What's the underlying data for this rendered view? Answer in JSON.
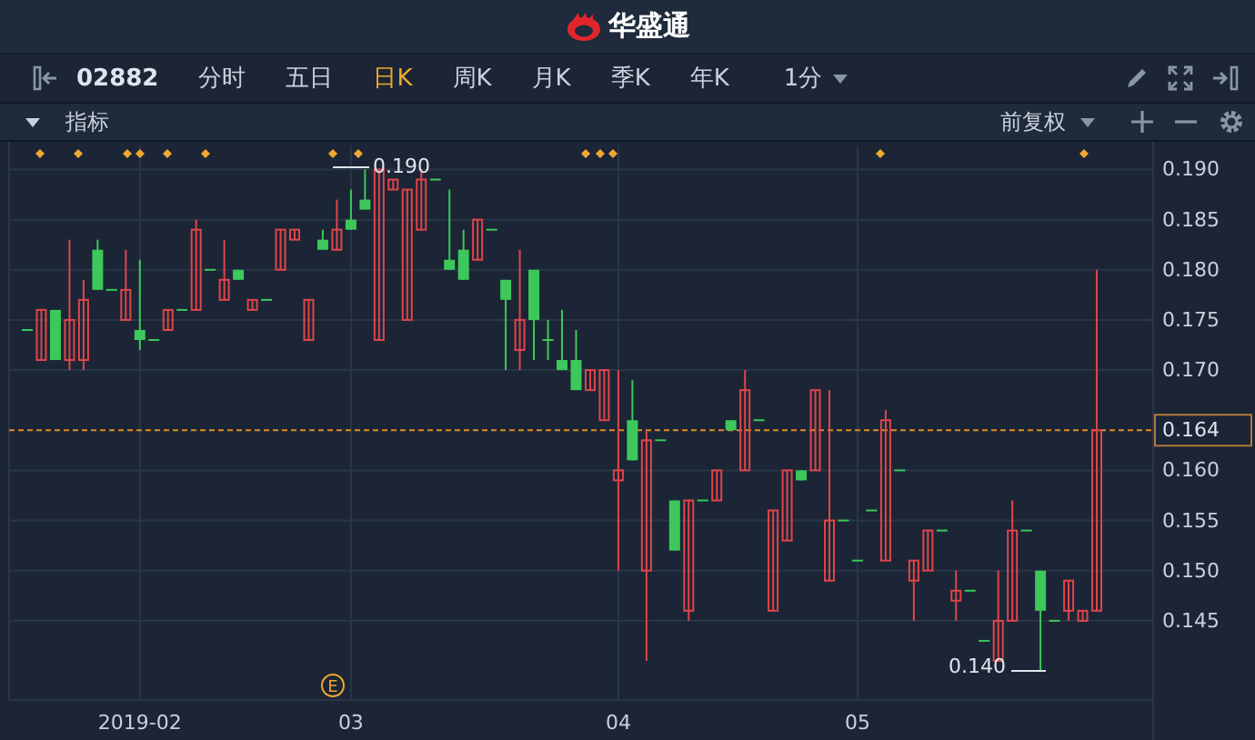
{
  "app_title": "华盛通",
  "toolbar": {
    "symbol": "02882",
    "periods": [
      {
        "label": "分时",
        "selected": false
      },
      {
        "label": "五日",
        "selected": false
      },
      {
        "label": "日K",
        "selected": true
      },
      {
        "label": "周K",
        "selected": false
      },
      {
        "label": "月K",
        "selected": false
      },
      {
        "label": "季K",
        "selected": false
      },
      {
        "label": "年K",
        "selected": false
      }
    ],
    "interval": "1分"
  },
  "indicator_bar": {
    "label": "指标",
    "adjustment": "前复权"
  },
  "chart": {
    "high_label": "0.190",
    "low_label": "0.140",
    "event_marker": "E",
    "chart_data": {
      "type": "candlestick",
      "ylim": [
        0.1371,
        0.1924
      ],
      "grid": true,
      "ref_lines": [
        {
          "axis": "y",
          "value": 0.164,
          "label": "0.164"
        }
      ],
      "yticks": [
        {
          "value": 0.19,
          "label": "0.190"
        },
        {
          "value": 0.185,
          "label": "0.185"
        },
        {
          "value": 0.18,
          "label": "0.180"
        },
        {
          "value": 0.175,
          "label": "0.175"
        },
        {
          "value": 0.17,
          "label": "0.170"
        },
        {
          "value": 0.16,
          "label": "0.160"
        },
        {
          "value": 0.155,
          "label": "0.155"
        },
        {
          "value": 0.15,
          "label": "0.150"
        },
        {
          "value": 0.145,
          "label": "0.145"
        }
      ],
      "categories": [
        null,
        null,
        null,
        null,
        null,
        null,
        null,
        null,
        "2019-02",
        null,
        null,
        null,
        null,
        null,
        null,
        null,
        null,
        null,
        null,
        null,
        null,
        null,
        null,
        "03",
        null,
        null,
        null,
        null,
        null,
        null,
        null,
        null,
        null,
        null,
        null,
        null,
        null,
        null,
        null,
        null,
        null,
        null,
        "04",
        null,
        null,
        null,
        null,
        null,
        null,
        null,
        null,
        null,
        null,
        null,
        null,
        null,
        null,
        null,
        null,
        "05",
        null,
        null,
        null,
        null,
        null,
        null,
        null,
        null,
        null,
        null,
        null,
        null,
        null,
        null,
        null,
        null,
        null
      ],
      "ohlc": [
        [
          0.174,
          0.174,
          0.174,
          0.174
        ],
        [
          0.171,
          0.176,
          0.171,
          0.176
        ],
        [
          0.176,
          0.176,
          0.171,
          0.171
        ],
        [
          0.171,
          0.183,
          0.17,
          0.175
        ],
        [
          0.171,
          0.179,
          0.17,
          0.177
        ],
        [
          0.182,
          0.183,
          0.178,
          0.178
        ],
        [
          0.178,
          0.178,
          0.178,
          0.178
        ],
        [
          0.175,
          0.182,
          0.175,
          0.178
        ],
        [
          0.174,
          0.181,
          0.172,
          0.173
        ],
        [
          0.173,
          0.173,
          0.173,
          0.173
        ],
        [
          0.174,
          0.176,
          0.174,
          0.176
        ],
        [
          0.176,
          0.176,
          0.176,
          0.176
        ],
        [
          0.176,
          0.185,
          0.176,
          0.184
        ],
        [
          0.18,
          0.18,
          0.18,
          0.18
        ],
        [
          0.177,
          0.183,
          0.177,
          0.179
        ],
        [
          0.18,
          0.18,
          0.179,
          0.179
        ],
        [
          0.176,
          0.177,
          0.176,
          0.177
        ],
        [
          0.177,
          0.177,
          0.177,
          0.177
        ],
        [
          0.18,
          0.184,
          0.18,
          0.184
        ],
        [
          0.183,
          0.184,
          0.183,
          0.184
        ],
        [
          0.173,
          0.177,
          0.173,
          0.177
        ],
        [
          0.183,
          0.184,
          0.182,
          0.182
        ],
        [
          0.182,
          0.187,
          0.182,
          0.184
        ],
        [
          0.185,
          0.188,
          0.184,
          0.184
        ],
        [
          0.187,
          0.19,
          0.186,
          0.186
        ],
        [
          0.173,
          0.19,
          0.173,
          0.19
        ],
        [
          0.188,
          0.189,
          0.188,
          0.189
        ],
        [
          0.175,
          0.188,
          0.175,
          0.188
        ],
        [
          0.184,
          0.19,
          0.184,
          0.189
        ],
        [
          0.189,
          0.189,
          0.189,
          0.189
        ],
        [
          0.181,
          0.188,
          0.18,
          0.18
        ],
        [
          0.182,
          0.184,
          0.179,
          0.179
        ],
        [
          0.181,
          0.185,
          0.181,
          0.185
        ],
        [
          0.184,
          0.184,
          0.184,
          0.184
        ],
        [
          0.179,
          0.179,
          0.17,
          0.177
        ],
        [
          0.172,
          0.182,
          0.17,
          0.175
        ],
        [
          0.18,
          0.18,
          0.171,
          0.175
        ],
        [
          0.173,
          0.175,
          0.171,
          0.173
        ],
        [
          0.171,
          0.176,
          0.17,
          0.17
        ],
        [
          0.171,
          0.174,
          0.168,
          0.168
        ],
        [
          0.168,
          0.17,
          0.168,
          0.17
        ],
        [
          0.165,
          0.17,
          0.165,
          0.17
        ],
        [
          0.159,
          0.17,
          0.15,
          0.16
        ],
        [
          0.165,
          0.169,
          0.161,
          0.161
        ],
        [
          0.15,
          0.164,
          0.141,
          0.163
        ],
        [
          0.163,
          0.163,
          0.163,
          0.163
        ],
        [
          0.157,
          0.157,
          0.152,
          0.152
        ],
        [
          0.146,
          0.157,
          0.145,
          0.157
        ],
        [
          0.157,
          0.157,
          0.157,
          0.157
        ],
        [
          0.157,
          0.16,
          0.157,
          0.16
        ],
        [
          0.165,
          0.165,
          0.164,
          0.164
        ],
        [
          0.16,
          0.17,
          0.16,
          0.168
        ],
        [
          0.165,
          0.165,
          0.165,
          0.165
        ],
        [
          0.146,
          0.156,
          0.146,
          0.156
        ],
        [
          0.153,
          0.16,
          0.153,
          0.16
        ],
        [
          0.16,
          0.16,
          0.159,
          0.159
        ],
        [
          0.16,
          0.168,
          0.16,
          0.168
        ],
        [
          0.149,
          0.168,
          0.149,
          0.155
        ],
        [
          0.155,
          0.155,
          0.155,
          0.155
        ],
        [
          0.151,
          0.151,
          0.151,
          0.151
        ],
        [
          0.156,
          0.156,
          0.156,
          0.156
        ],
        [
          0.151,
          0.166,
          0.151,
          0.165
        ],
        [
          0.16,
          0.16,
          0.16,
          0.16
        ],
        [
          0.149,
          0.151,
          0.145,
          0.151
        ],
        [
          0.15,
          0.154,
          0.15,
          0.154
        ],
        [
          0.154,
          0.154,
          0.154,
          0.154
        ],
        [
          0.147,
          0.15,
          0.145,
          0.148
        ],
        [
          0.148,
          0.148,
          0.148,
          0.148
        ],
        [
          0.143,
          0.143,
          0.143,
          0.143
        ],
        [
          0.141,
          0.15,
          0.141,
          0.145
        ],
        [
          0.145,
          0.157,
          0.145,
          0.154
        ],
        [
          0.154,
          0.154,
          0.154,
          0.154
        ],
        [
          0.15,
          0.15,
          0.14,
          0.146
        ],
        [
          0.145,
          0.145,
          0.145,
          0.145
        ],
        [
          0.146,
          0.149,
          0.145,
          0.149
        ],
        [
          0.145,
          0.146,
          0.145,
          0.146
        ],
        [
          0.146,
          0.18,
          0.146,
          0.164
        ]
      ]
    }
  }
}
